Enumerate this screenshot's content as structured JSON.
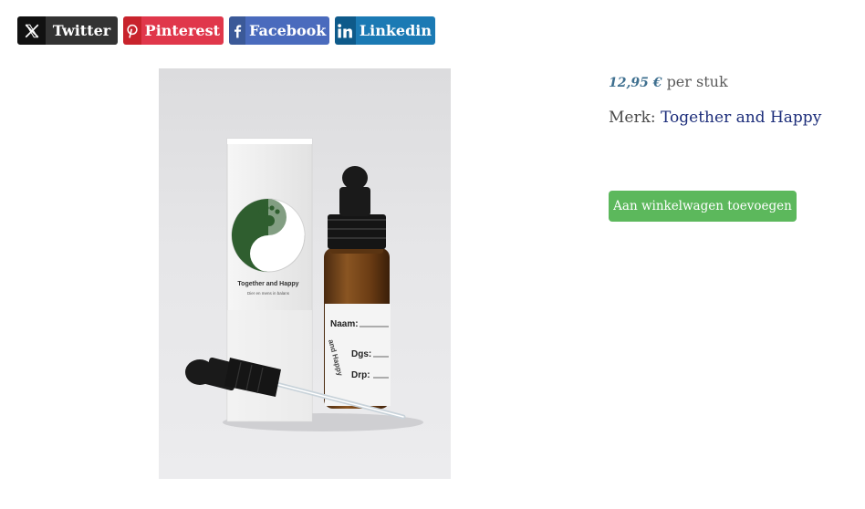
{
  "share": {
    "twitter": {
      "label": "Twitter",
      "icon": "x-logo-icon",
      "icon_bg": "#111111",
      "bg": "#333333"
    },
    "pinterest": {
      "label": "Pinterest",
      "icon": "pinterest-icon",
      "icon_bg": "#c8232c",
      "bg": "#e0374b"
    },
    "facebook": {
      "label": "Facebook",
      "icon": "facebook-icon",
      "icon_bg": "#3b5998",
      "bg": "#4a6bbd"
    },
    "linkedin": {
      "label": "Linkedin",
      "icon": "linkedin-icon",
      "icon_bg": "#0e5a8a",
      "bg": "#1b7ab4"
    }
  },
  "product": {
    "price": "12,95 €",
    "price_unit": "per stuk",
    "brand_label": "Merk:",
    "brand_name": "Together and Happy",
    "add_to_cart_label": "Aan winkelwagen toevoegen"
  },
  "image": {
    "box_logo_title": "Together and Happy",
    "box_logo_subtitle": "Dier en mens in balans",
    "label_name": "Naam:",
    "label_dgs": "Dgs:",
    "label_drp": "Drp:",
    "label_side": "and Happy"
  },
  "colors": {
    "add_to_cart": "#5cb85c",
    "brand_link": "#1c2d7a",
    "price": "#3e6f8f"
  }
}
